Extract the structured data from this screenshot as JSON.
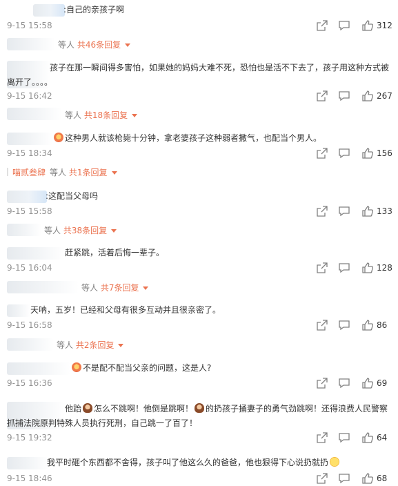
{
  "comments": [
    {
      "id": 1,
      "text": ":自己的亲孩子啊",
      "time": "9-15 15:58",
      "likes": "312"
    },
    {
      "id": 2,
      "text": "孩子在那一瞬间得多害怕，如果她的妈妈大难不死，恐怕也是活不下去了，孩子用这种方式被离开了。。。。",
      "time": "9-15 16:42",
      "likes": "267"
    },
    {
      "id": 3,
      "text": "这种男人就该枪毙十分钟，拿老婆孩子这种弱者撒气，也配当个男人。",
      "time": "9-15 18:34",
      "likes": "156"
    },
    {
      "id": 4,
      "text": ":这配当父母吗",
      "time": "9-15 15:58",
      "likes": "133"
    },
    {
      "id": 5,
      "text": "赶紧跳，活着后悔一辈子。",
      "time": "9-15 16:04",
      "likes": "128"
    },
    {
      "id": 6,
      "text": "天呐，五岁！已经和父母有很多互动并且很亲密了。",
      "time": "9-15 16:58",
      "likes": "86"
    },
    {
      "id": 7,
      "text": "不是配不配当父亲的问题，这是人?",
      "time": "9-15 16:36",
      "likes": "69"
    },
    {
      "id": 8,
      "text_a": "他跆",
      "text_b": "怎么不跳啊！他倒是跳啊！",
      "text_c": "的扔孩子捅妻子的勇气劲跳啊！还得浪费人民警察抓捕法院原判特殊人员执行死刑，自己跳一了百了！",
      "time": "9-15 19:32",
      "likes": "64"
    },
    {
      "id": 9,
      "text": "我平时砸个东西都不舍得，孩子叫了他这么久的爸爸，他也狠得下心说扔就扔",
      "time": "9-15 18:46",
      "likes": "68"
    }
  ],
  "replies": [
    {
      "prefix": "等人",
      "count": "共46条回复"
    },
    {
      "prefix": "等人",
      "count": "共18条回复"
    },
    {
      "nick": "喵贰叁肆",
      "prefix": "等人",
      "count": "共1条回复"
    },
    {
      "prefix": "等人",
      "count": "共38条回复"
    },
    {
      "prefix": "等人",
      "count": "共7条回复"
    },
    {
      "prefix": "等人",
      "count": "共2条回复"
    }
  ],
  "icons": {
    "share": "share-icon",
    "comment": "comment-icon",
    "like": "thumbs-up-icon"
  },
  "colors": {
    "accent": "#eb7350",
    "time": "#939393",
    "text": "#333333"
  }
}
